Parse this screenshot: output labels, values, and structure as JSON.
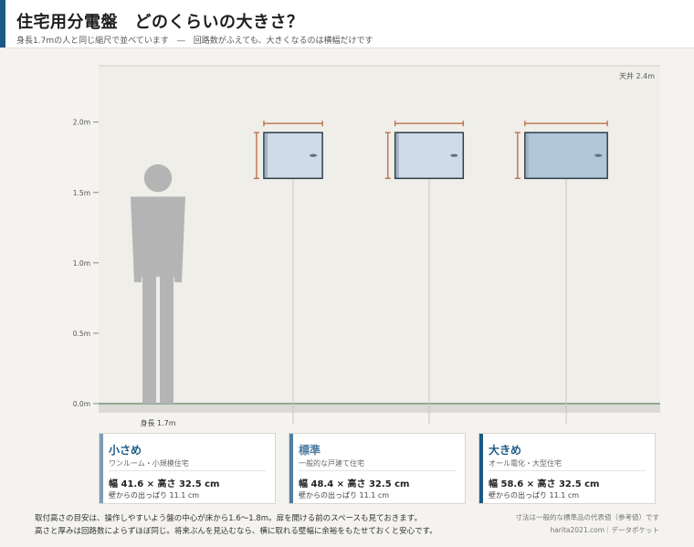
{
  "header": {
    "title": "住宅用分電盤　どのくらいの大きさ？",
    "subtitle": "身長1.7mの人と同じ縮尺で並べています　―　回路数がふえても、大きくなるのは横幅だけです"
  },
  "chart_data": {
    "type": "diagram",
    "ylim": [
      0,
      2.4
    ],
    "y_ticks": [
      {
        "value": 0.0,
        "label": "0.0m"
      },
      {
        "value": 0.5,
        "label": "0.5m"
      },
      {
        "value": 1.0,
        "label": "1.0m"
      },
      {
        "value": 1.5,
        "label": "1.5m"
      },
      {
        "value": 2.0,
        "label": "2.0m"
      }
    ],
    "ceiling": {
      "value": 2.4,
      "label": "天井 2.4m"
    },
    "person": {
      "height_m": 1.7,
      "label": "身長 1.7m"
    },
    "panel_bottom_m": 1.6,
    "panels": [
      {
        "name": "小さめ",
        "desc": "ワンルーム・小規模住宅",
        "width_cm": 41.6,
        "height_cm": 32.5,
        "depth_cm": 11.1,
        "dims_text": "幅 41.6 × 高さ 32.5 cm",
        "depth_text": "壁からの出っぱり 11.1 cm",
        "accent": "#7d9bb5",
        "fill": "#cfdbe6"
      },
      {
        "name": "標準",
        "desc": "一般的な戸建て住宅",
        "width_cm": 48.4,
        "height_cm": 32.5,
        "depth_cm": 11.1,
        "dims_text": "幅 48.4 × 高さ 32.5 cm",
        "depth_text": "壁からの出っぱり 11.1 cm",
        "accent": "#4f7ea3",
        "fill": "#cfdbe6"
      },
      {
        "name": "大きめ",
        "desc": "オール電化・大型住宅",
        "width_cm": 58.6,
        "height_cm": 32.5,
        "depth_cm": 11.1,
        "dims_text": "幅 58.6 × 高さ 32.5 cm",
        "depth_text": "壁からの出っぱり 11.1 cm",
        "accent": "#1b5a86",
        "fill": "#b1c6d9"
      }
    ]
  },
  "colors": {
    "accent": "#1b5a86",
    "dimension_mark": "#c0704a",
    "person": "#b4b4b4",
    "floor": "#8faa91",
    "wall": "#efeee9"
  },
  "footer": {
    "note_1": "取付高さの目安は、操作しやすいよう盤の中心が床から1.6〜1.8m。扉を開ける前のスペースも見ておきます。",
    "note_2": "高さと厚みは回路数によらずほぼ同じ。将来ぶんを見込むなら、横に取れる壁幅に余裕をもたせておくと安心です。",
    "source_1": "寸法は一般的な標準品の代表値（参考値）です",
    "source_2": "harita2021.com｜データポケット"
  }
}
